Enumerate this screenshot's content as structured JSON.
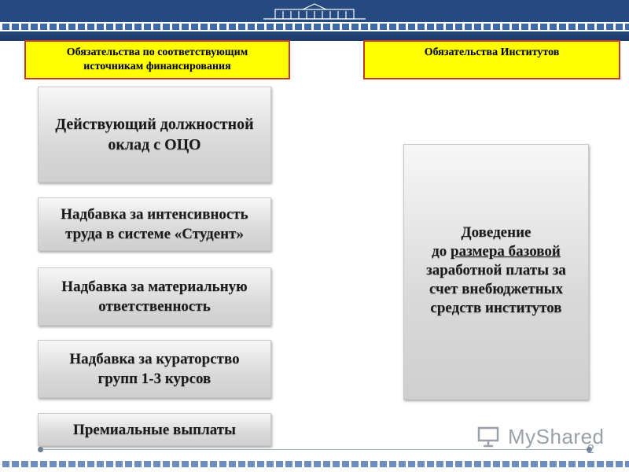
{
  "header": {
    "emblem": "university-building-icon"
  },
  "left_header": {
    "line1": "Обязательства по соответствующим",
    "line2": "источникам финансирования"
  },
  "right_header": {
    "label": "Обязательства Институтов"
  },
  "left_items": [
    {
      "line1": "Действующий должностной",
      "line2": "оклад с ОЦО"
    },
    {
      "line1": "Надбавка за интенсивность",
      "line2": "труда в системе «Студент»"
    },
    {
      "line1": "Надбавка за материальную",
      "line2": "ответственность"
    },
    {
      "line1": "Надбавка за кураторство",
      "line2": "групп 1-3 курсов"
    },
    {
      "line1": "Премиальные выплаты"
    }
  ],
  "right_item": {
    "line1": "Доведение",
    "line2_prefix": "до ",
    "line2_underlined": "размера базовой",
    "line3": "заработной платы  за",
    "line4": "счет внебюджетных",
    "line5": "средств институтов"
  },
  "watermark": {
    "text": "MyShared"
  },
  "page_number": "2",
  "colors": {
    "header_blue": "#244a80",
    "yellow": "#ffff00",
    "yellow_border": "#c0392b"
  }
}
